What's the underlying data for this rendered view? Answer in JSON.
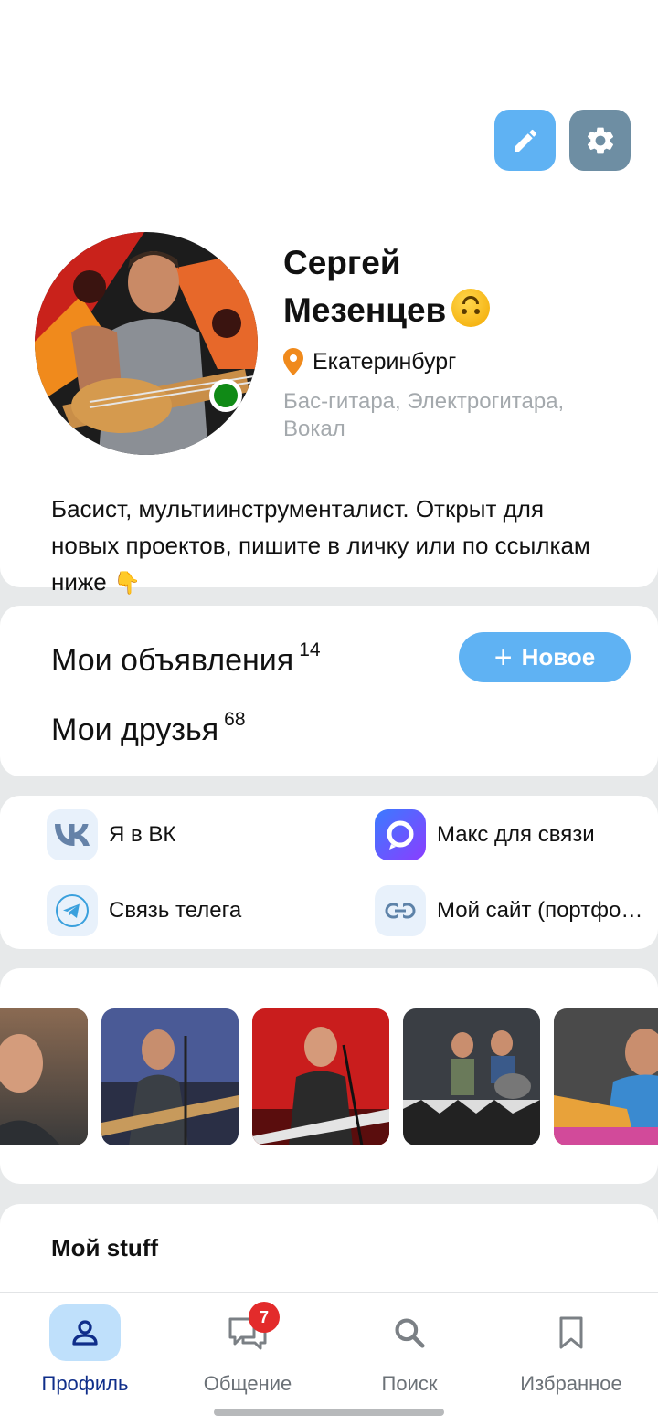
{
  "profile": {
    "name_line1": "Сергей",
    "name_line2": "Мезенцев",
    "status_emoji": "upside-down-face-emoji",
    "location": "Екатеринбург",
    "instruments": "Бас-гитара, Электрогитара, Вокал",
    "bio": "Басист, мультиинструменталист. Открыт для новых проектов, пишите в личку или по ссылкам ниже",
    "bio_emoji": "👇",
    "online": true
  },
  "actions": {
    "edit_icon": "pencil-icon",
    "settings_icon": "gear-icon"
  },
  "counters": {
    "ads_label": "Мои объявления",
    "ads_count": "14",
    "friends_label": "Мои друзья",
    "friends_count": "68",
    "new_button": "Новое"
  },
  "links": [
    {
      "label": "Я в ВК",
      "icon": "vk-icon"
    },
    {
      "label": "Макс для связи",
      "icon": "max-messenger-icon"
    },
    {
      "label": "Связь телега",
      "icon": "telegram-icon"
    },
    {
      "label": "Мой сайт (портфо…",
      "icon": "link-icon"
    }
  ],
  "stuff": {
    "title": "Мой stuff"
  },
  "nav": [
    {
      "label": "Профиль",
      "icon": "person-icon",
      "active": true
    },
    {
      "label": "Общение",
      "icon": "chat-icon",
      "badge": "7"
    },
    {
      "label": "Поиск",
      "icon": "search-icon"
    },
    {
      "label": "Избранное",
      "icon": "bookmark-icon"
    }
  ],
  "colors": {
    "accent": "#5fb2f3",
    "settings": "#6e8ea3",
    "online": "#108a16",
    "badge": "#e32b2b",
    "location_pin": "#f08a1c"
  }
}
